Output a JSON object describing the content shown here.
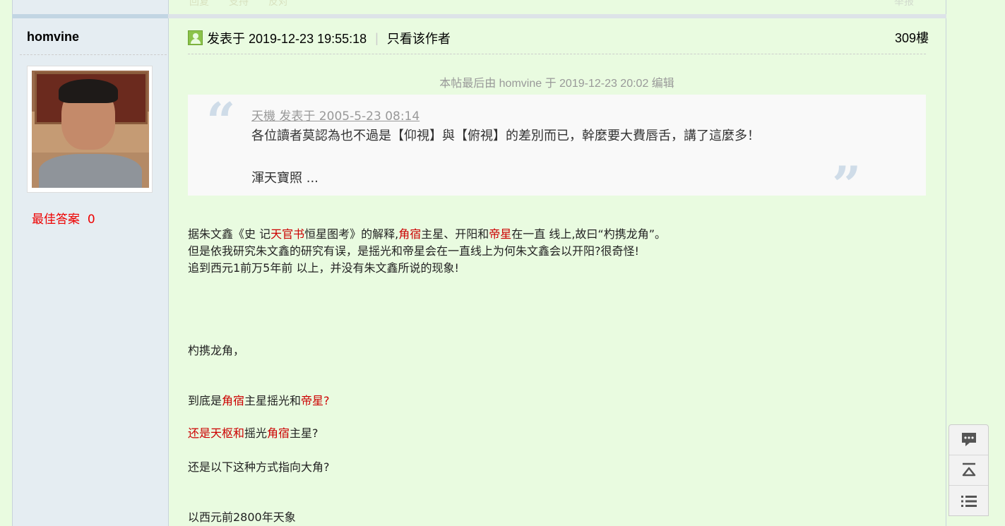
{
  "top_actions": {
    "reply": "回复",
    "support": "支持",
    "oppose": "反对",
    "report": "举报"
  },
  "author": {
    "name": "homvine",
    "best_answer_label": "最佳答案",
    "best_answer_count": "0"
  },
  "post": {
    "posted_at": "发表于 2019-12-23 19:55:18",
    "only_author": "只看该作者",
    "floor": "309樓",
    "edit_note": "本帖最后由 homvine 于 2019-12-23 20:02 编辑"
  },
  "quote": {
    "cite": "天機 发表于 2005-5-23 08:14",
    "line1": "各位讀者莫認為也不過是【仰視】與【俯視】的差別而已，幹麼要大費唇舌，講了這麼多！",
    "line2": "渾天寶照 ..."
  },
  "body": {
    "l1_a": "据朱文鑫《史 记",
    "l1_b": "天官书",
    "l1_c": "恒星图考》的解释,",
    "l1_d": "角宿",
    "l1_e": "主星、开阳和",
    "l1_f": "帝星",
    "l1_g": "在一直 线上,故曰“杓携龙角”。",
    "l2": "但是依我研究朱文鑫的研究有误，是摇光和帝星会在一直线上为何朱文鑫会以开阳?很奇怪!",
    "l3": "追到西元1前万5年前 以上，并没有朱文鑫所说的现象!",
    "l4": "杓携龙角，",
    "l5_a": "到底是",
    "l5_b": "角宿",
    "l5_c": "主星摇光和",
    "l5_d": "帝星?",
    "l6_a": "还是天枢和",
    "l6_b": "摇光",
    "l6_c": "角宿",
    "l6_d": "主星?",
    "l7": "还是以下这种方式指向大角?",
    "l8": "以西元前2800年天象"
  },
  "float_bar": {
    "icons": [
      "comment-icon",
      "back-to-top-icon",
      "list-icon"
    ]
  }
}
